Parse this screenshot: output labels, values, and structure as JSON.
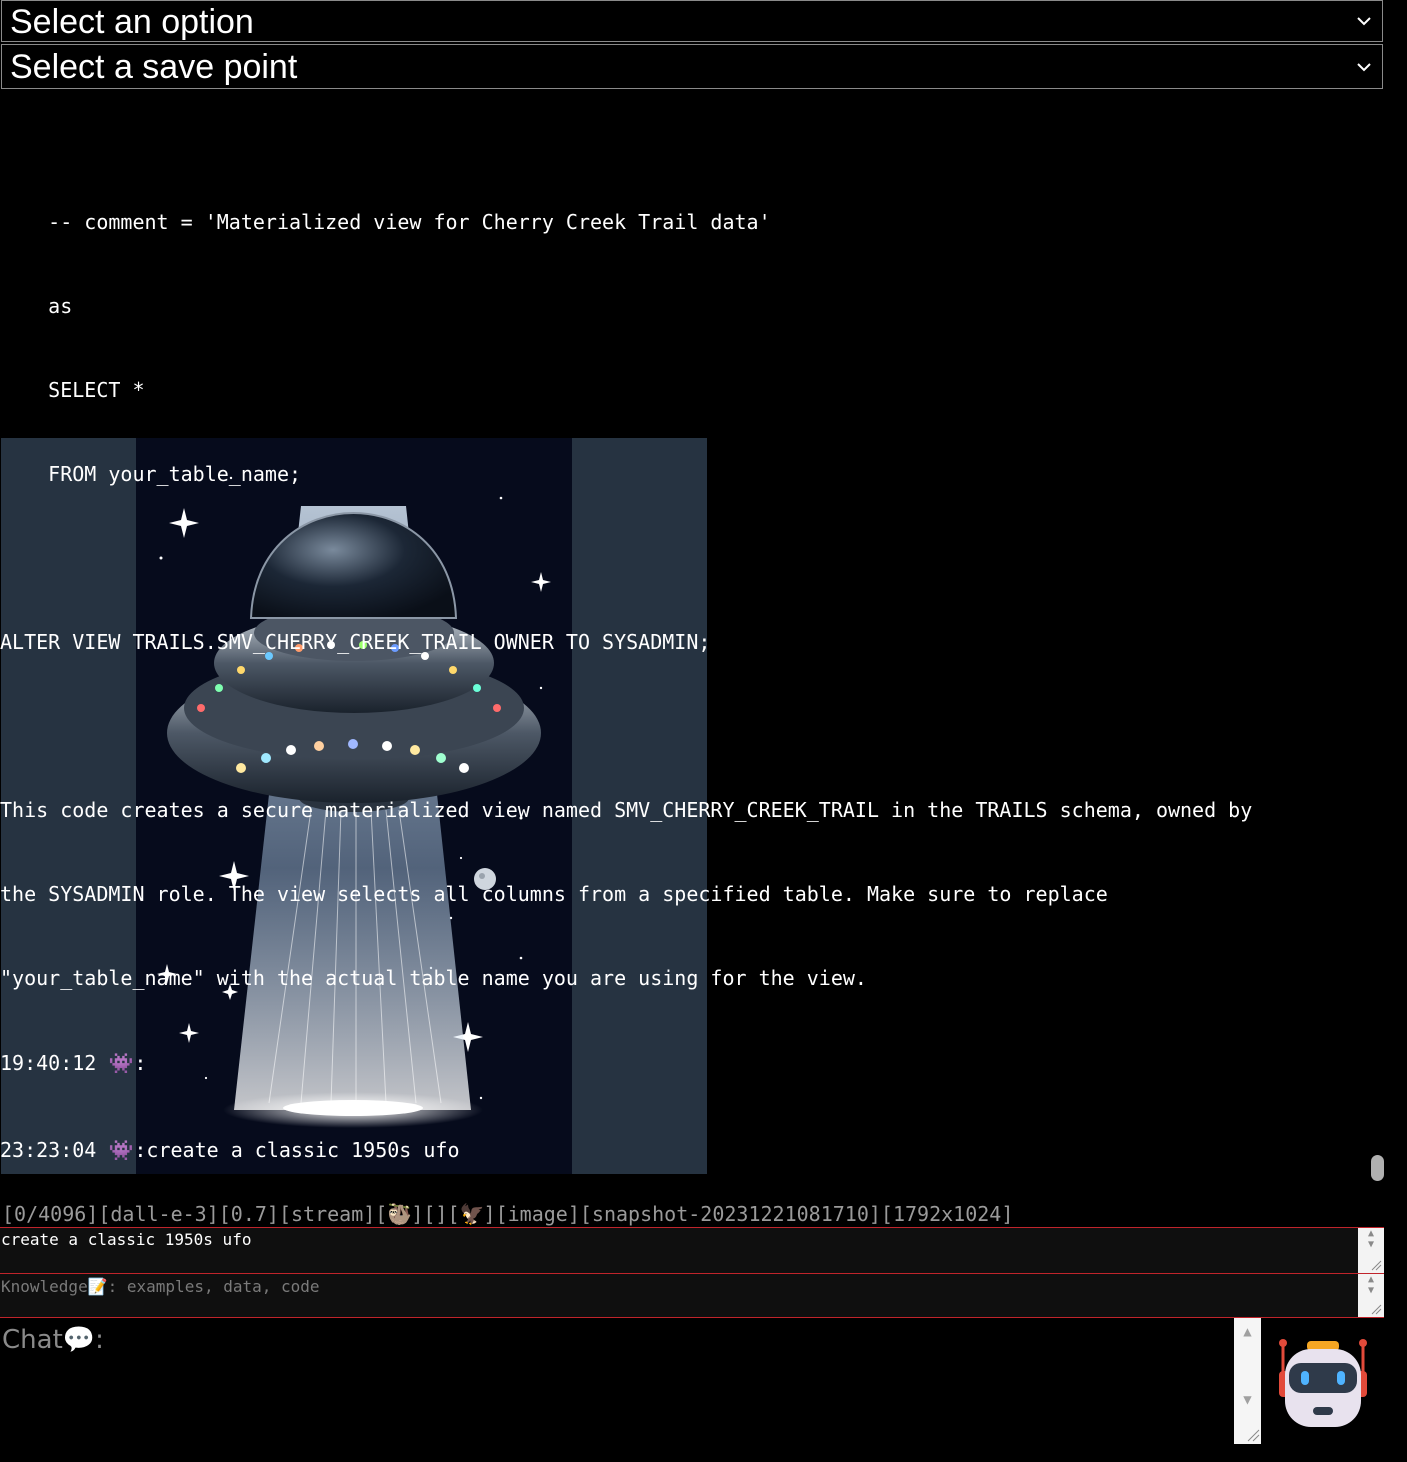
{
  "selects": {
    "option": "Select an option",
    "save_point": "Select a save point"
  },
  "transcript": {
    "code_lines": [
      "    -- comment = 'Materialized view for Cherry Creek Trail data'",
      "    as",
      "    SELECT *",
      "    FROM your_table_name;",
      "",
      "ALTER VIEW TRAILS.SMV_CHERRY_CREEK_TRAIL OWNER TO SYSADMIN;",
      "",
      "This code creates a secure materialized view named SMV_CHERRY_CREEK_TRAIL in the TRAILS schema, owned by",
      "the SYSADMIN role. The view selects all columns from a specified table. Make sure to replace",
      "\"your_table_name\" with the actual table name you are using for the view."
    ],
    "entries": [
      {
        "time": "19:40:12",
        "text": ":"
      },
      {
        "time": "23:23:04",
        "text": ":create a classic 1950s ufo"
      }
    ],
    "image_icon": "alien-monster-icon",
    "generated_image": "ufo-illustration"
  },
  "status": {
    "tokens": "[0/4096]",
    "model": "[dall-e-3]",
    "temperature": "[0.7]",
    "mode": "[stream]",
    "emoji1_open": "[",
    "emoji1_close": "]",
    "empty": "[]",
    "emoji2_open": "[",
    "emoji2_close": "]",
    "type": "[image]",
    "snapshot": "[snapshot-20231221081710]",
    "size": "[1792x1024]"
  },
  "prompt": {
    "value": "create a classic 1950s ufo"
  },
  "knowledge": {
    "label": "Knowledge",
    "suffix": ": examples, data, code"
  },
  "chat": {
    "label": "Chat",
    "suffix": ":"
  },
  "colors": {
    "background": "#000000",
    "border_red": "#c0242b",
    "alien": "#8e6bb3",
    "image_side": "#263341"
  }
}
